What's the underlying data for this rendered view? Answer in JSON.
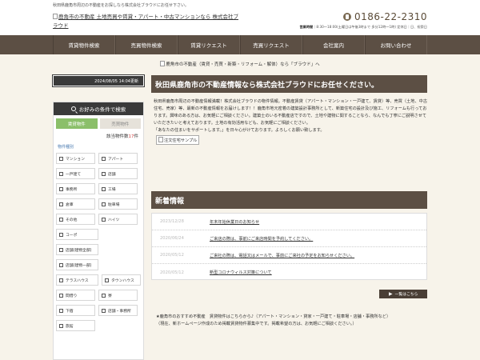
{
  "header": {
    "tagline": "秋田県鹿角市周辺の不動産をお探しなら株式会社ブラウドにお任せ下さい。",
    "logo_alt": "鹿角市の不動産 土地売買や賃貸・アパート・中古マンションなら 株式会社ブラウド",
    "phone": "0186-22-2310",
    "hours_label": "営業時間",
    "hours_text": "8:30～18:00(土曜日は午後3時まで 多分12時～1時) 定休日",
    "closed_text": "日、祝祭日"
  },
  "nav": {
    "items": [
      "賃貸物件検索",
      "売買物件検索",
      "賃貸リクエスト",
      "売買リクエスト",
      "会社案内",
      "お問い合わせ"
    ]
  },
  "banner": {
    "text": "鹿角市の不動産（賃貸・売買・新築・リフォーム・解体）なら「ブラウド」へ"
  },
  "sidebar": {
    "updated": "2024/08/05 14:04更新",
    "search_title": "お好みの条件で検索",
    "tab_rent": "賃貸物件",
    "tab_sale": "売買物件",
    "count_prefix": "該当物件数",
    "count_value": "17",
    "count_suffix": "件",
    "type_label": "物件種別",
    "options": [
      "マンション",
      "アパート",
      "一戸建て",
      "店舗",
      "事務所",
      "工場",
      "倉庫",
      "駐車場",
      "その他",
      "ハイツ",
      "コーポ",
      "店舗(建物全部)",
      "店舗(建物一部)",
      "テラスハウス",
      "タウンハウス",
      "間借り",
      "寮",
      "下宿",
      "店舗・事務所",
      "旅館"
    ]
  },
  "main": {
    "title": "秋田県鹿角市の不動産情報なら株式会社ブラウドにお任せください。",
    "intro": "秋田県鹿角市周辺の不動産情報満載！株式会社ブラウドの物件情報。不動産賃貸（アパート・マンション・一戸建て、賃貸）等、売買（土地、中古住宅、売家）等、最新の不動産情報をお届けします！！鹿角市地元密着の建築設計事務所として、新築住宅の設計及び施工、リフォームも行っております。興味のある方は、お気軽にご相談ください。建築士のいる不動産店ですので、土地や建物に関することなら、なんでも丁寧にご説明させていただきたいと考えております。土地の有効活用なども、お気軽にご相談ください。",
    "intro2": "「あなたの住まいをサポートします。」を日々心がけております。よろしくお願い致します。",
    "image_alt": "注文住宅サンプル",
    "news_title": "新着情報",
    "news": [
      {
        "date": "2023/12/28",
        "title": "年末年始休業日のお知らせ"
      },
      {
        "date": "2020/06/24",
        "title": "ご来店の際は、事前にご来店時間を予約してください。"
      },
      {
        "date": "2020/05/12",
        "title": "ご来社の際は、電話又はメールで、事前にご来社の予定をお知らせください。"
      },
      {
        "date": "2020/05/12",
        "title": "新型コロナウィルス対策について"
      }
    ],
    "list_button": "一覧はこちら",
    "rec_text": "★鹿角市のおすすめ不動産　賃貸物件はこちらから♪（アパート・マンション・貸家・一戸建て・駐車場・店舗・事務所など）",
    "rec_note": "（現在、新ホームページ作成のため掲載賃貸物件募集中です。掲載希望の方は、お気軽にご相談ください。）"
  }
}
